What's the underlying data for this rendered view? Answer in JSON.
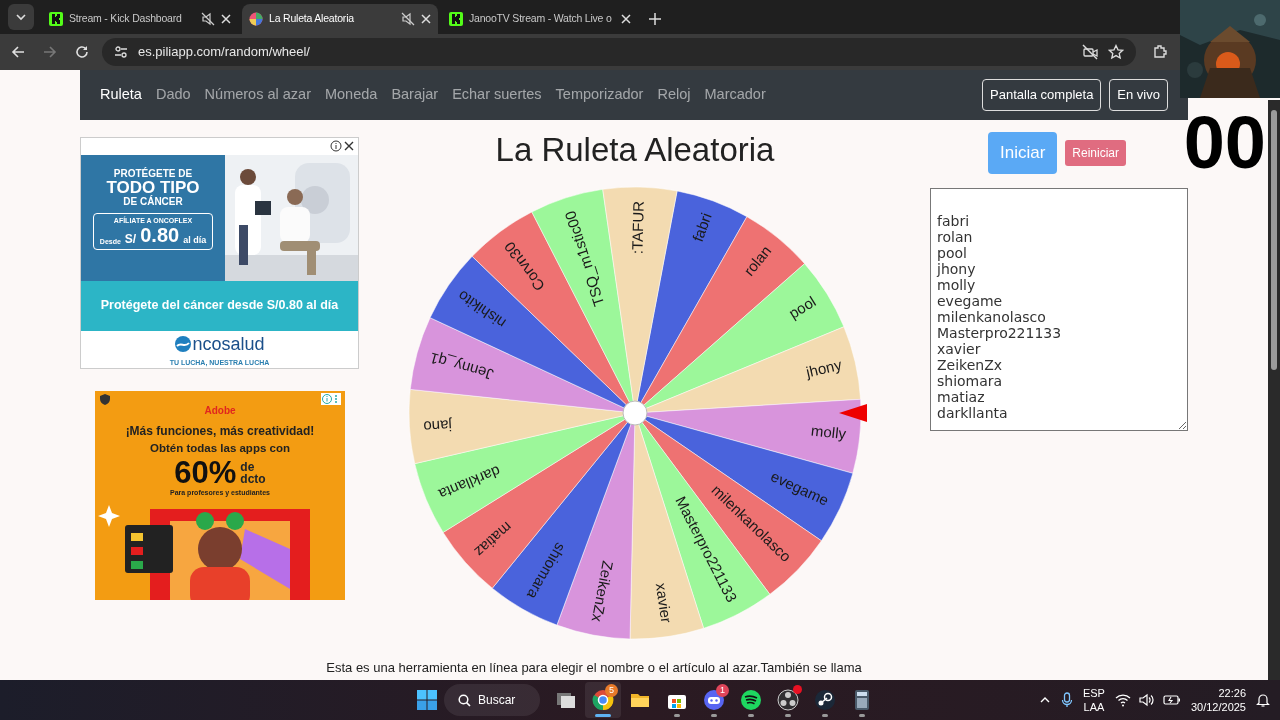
{
  "browser": {
    "tabs": [
      {
        "title": "Stream - Kick Dashboard",
        "kind": "kick",
        "muted": true,
        "selected": false
      },
      {
        "title": "La Ruleta Aleatoria",
        "kind": "wheel",
        "muted": true,
        "selected": true
      },
      {
        "title": "JanooTV Stream - Watch Live o",
        "kind": "kick",
        "muted": false,
        "selected": false
      }
    ],
    "address": "es.piliapp.com/random/wheel/"
  },
  "navbar": {
    "items": [
      {
        "label": "Ruleta",
        "selected": true
      },
      {
        "label": "Dado",
        "selected": false
      },
      {
        "label": "Números al azar",
        "selected": false
      },
      {
        "label": "Moneda",
        "selected": false
      },
      {
        "label": "Barajar",
        "selected": false
      },
      {
        "label": "Echar suertes",
        "selected": false
      },
      {
        "label": "Temporizador",
        "selected": false
      },
      {
        "label": "Reloj",
        "selected": false
      },
      {
        "label": "Marcador",
        "selected": false
      }
    ],
    "buttons": [
      "Pantalla completa",
      "En vivo"
    ]
  },
  "ads": [
    {
      "kind": "health",
      "headline": [
        "PROTÉGETE DE",
        "TODO TIPO",
        "DE CÁNCER"
      ],
      "offer": "AFÍLIATE A ONCOFLEX",
      "from": "Desde",
      "currency": "S/",
      "price": "0.80",
      "per": "al día",
      "caption": "Protégete del cáncer desde S/0.80 al día",
      "brand": "ncosalud",
      "tagline": "TU LUCHA, NUESTRA LUCHA"
    },
    {
      "kind": "software",
      "brand": "Adobe",
      "headline": "¡Más funciones, más creatividad!",
      "subline": "Obtén todas las apps con",
      "discount": "60%",
      "discount_unit": [
        "de",
        "dcto"
      ],
      "note": "Para profesores y estudiantes"
    }
  ],
  "main": {
    "title": "La Ruleta Aleatoria",
    "start_button": "Iniciar",
    "reset_button": "Reiniciar",
    "timer": "00",
    "entries": [
      "fabri",
      "rolan",
      "pool",
      "jhony",
      "molly",
      "evegame",
      "milenkanolasco",
      "Masterpro221133",
      "xavier",
      "ZeikenZx",
      "shiomara",
      "matiaz",
      "darkllanta"
    ],
    "wheel": {
      "segments": [
        {
          "label": "fabri",
          "color": "#4a63dc"
        },
        {
          "label": "rolan",
          "color": "#ee7272"
        },
        {
          "label": "pool",
          "color": "#9cf79a"
        },
        {
          "label": "jhony",
          "color": "#f3dbb1"
        },
        {
          "label": "molly",
          "color": "#d894dc"
        },
        {
          "label": "evegame",
          "color": "#4a63dc"
        },
        {
          "label": "milenkanolasco",
          "color": "#ee7272"
        },
        {
          "label": "Masterpro221133",
          "color": "#9cf79a"
        },
        {
          "label": "xavier",
          "color": "#f3dbb1"
        },
        {
          "label": "ZeikenZx",
          "color": "#d894dc"
        },
        {
          "label": "shiomara",
          "color": "#4a63dc"
        },
        {
          "label": "matiaz",
          "color": "#ee7272"
        },
        {
          "label": "darkllanta",
          "color": "#9cf79a"
        },
        {
          "label": "jano",
          "color": "#f3dbb1"
        },
        {
          "label": "Jenny_q1",
          "color": "#d894dc"
        },
        {
          "label": "nishikito",
          "color": "#4a63dc"
        },
        {
          "label": "Corvn30",
          "color": "#ee7272"
        },
        {
          "label": "TSQ_m1stic00",
          "color": "#9cf79a"
        },
        {
          "label": ":TAFUR",
          "color": "#f3dbb1"
        }
      ]
    },
    "description": "Esta es una herramienta en línea para elegir el nombre o el artículo al azar.También se llama"
  },
  "taskbar": {
    "search": "Buscar",
    "apps": [
      {
        "kind": "taskview",
        "active": false,
        "running": false
      },
      {
        "kind": "browser",
        "active": true,
        "running": true,
        "badge": "5"
      },
      {
        "kind": "folder",
        "active": false,
        "running": false
      },
      {
        "kind": "store",
        "active": false,
        "running": true
      },
      {
        "kind": "chat",
        "active": false,
        "running": true,
        "badge": "1"
      },
      {
        "kind": "music",
        "active": false,
        "running": true
      },
      {
        "kind": "recorder",
        "active": false,
        "running": true,
        "alert": true
      },
      {
        "kind": "games",
        "active": false,
        "running": true
      },
      {
        "kind": "calculator",
        "active": false,
        "running": true
      }
    ],
    "language": [
      "ESP",
      "LAA"
    ],
    "time": "22:26",
    "date": "30/12/2025"
  }
}
